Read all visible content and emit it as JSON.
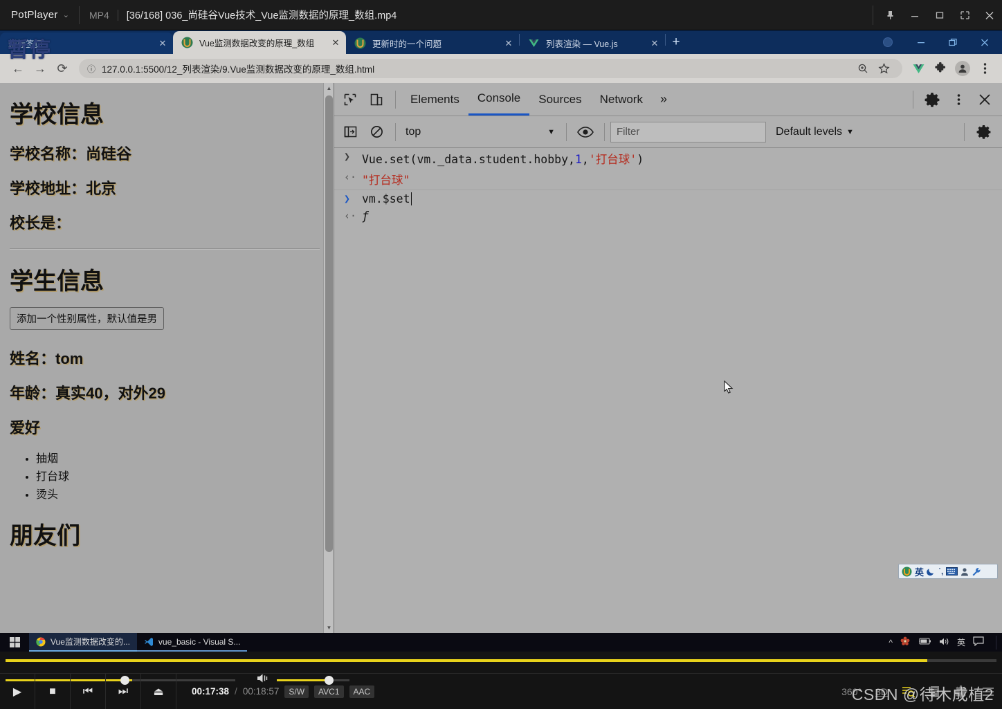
{
  "potplayer": {
    "app_name": "PotPlayer",
    "chevron": "⌄",
    "format": "MP4",
    "file_title": "[36/168] 036_尚硅谷Vue技术_Vue监测数据的原理_数组.mp4",
    "osd_text": "暂停",
    "window_buttons": [
      "pin",
      "minimize",
      "maximize",
      "fullscreen",
      "close"
    ],
    "controls": {
      "play_label": "▶",
      "stop_label": "■",
      "prev_label": "⏮",
      "next_label": "⏭",
      "eject_label": "⏏",
      "current_time": "00:17:38",
      "separator": "/",
      "total_time": "00:18:57",
      "badges": [
        "S/W",
        "AVC1",
        "AAC"
      ],
      "right_buttons": [
        "360°",
        "3D",
        "playlist-search",
        "playlist",
        "settings",
        "menu"
      ],
      "seek_percent": 93,
      "volume_percent": 72
    },
    "watermark": "CSDN @待木成植2"
  },
  "chrome": {
    "tabs": [
      {
        "title": "新标签页",
        "favicon": "none",
        "active": false
      },
      {
        "title": "Vue监测数据改变的原理_数组",
        "favicon": "vue-u",
        "active": true
      },
      {
        "title": "更新时的一个问题",
        "favicon": "vue-u",
        "active": false
      },
      {
        "title": "列表渲染 — Vue.js",
        "favicon": "vue-v",
        "active": false
      }
    ],
    "tab_close_label": "✕",
    "new_tab_label": "+",
    "window_buttons": [
      "minimize",
      "restore",
      "close"
    ],
    "toolbar": {
      "back_label": "←",
      "forward_label": "→",
      "reload_label": "⟳",
      "site_info_label": "ⓘ",
      "url": "127.0.0.1:5500/12_列表渲染/9.Vue监测数据改变的原理_数组.html",
      "icons": [
        "zoom-icon",
        "bookmark-star-icon",
        "vue-devtools-icon",
        "extensions-icon",
        "profile-icon",
        "menu-icon"
      ]
    }
  },
  "page": {
    "school_heading": "学校信息",
    "school_name": "学校名称：尚硅谷",
    "school_address": "学校地址：北京",
    "principal": "校长是：",
    "student_heading": "学生信息",
    "add_gender_button": "添加一个性别属性，默认值是男",
    "name": "姓名：tom",
    "age": "年龄：真实40，对外29",
    "hobby_heading": "爱好",
    "hobbies": [
      "抽烟",
      "打台球",
      "烫头"
    ],
    "friends_heading": "朋友们"
  },
  "devtools": {
    "inspect_icon": "inspect-element-icon",
    "device_icon": "device-toolbar-icon",
    "tabs": [
      "Elements",
      "Console",
      "Sources",
      "Network"
    ],
    "active_tab": "Console",
    "more_tabs_label": "»",
    "settings_icon": "gear-icon",
    "kebab_icon": "more-options-icon",
    "close_icon": "close-icon",
    "console_toolbar": {
      "sidebar_icon": "console-sidebar-icon",
      "clear_icon": "clear-console-icon",
      "context": "top",
      "context_caret": "▼",
      "eye_icon": "live-expression-icon",
      "filter_placeholder": "Filter",
      "filter_value": "",
      "levels_label": "Default levels",
      "levels_caret": "▼",
      "settings_icon": "console-settings-icon"
    },
    "console_rows": [
      {
        "kind": "input",
        "arrow": "❯",
        "segments": [
          {
            "t": "Vue.set(vm._data.student.hobby,",
            "c": "plain"
          },
          {
            "t": "1",
            "c": "num"
          },
          {
            "t": ",",
            "c": "plain"
          },
          {
            "t": "'打台球'",
            "c": "str"
          },
          {
            "t": ")",
            "c": "plain"
          }
        ]
      },
      {
        "kind": "result",
        "arrow": "‹·",
        "segments": [
          {
            "t": "\"打台球\"",
            "c": "str"
          }
        ]
      },
      {
        "kind": "prompt",
        "arrow": "❯",
        "segments": [
          {
            "t": "vm.$set",
            "c": "plain"
          }
        ]
      },
      {
        "kind": "result",
        "arrow": "‹·",
        "segments": [
          {
            "t": "ƒ",
            "c": "plain"
          }
        ]
      }
    ]
  },
  "ime": {
    "icons": [
      "sogou-logo-icon",
      "chinese-mode-icon",
      "moon-icon",
      "punctuation-icon",
      "keyboard-icon",
      "user-icon",
      "toolbox-icon"
    ],
    "mode_label": "英"
  },
  "taskbar": {
    "start_label": "start-icon",
    "items": [
      {
        "label": "Vue监测数据改变的...",
        "icon": "chrome-icon",
        "active": true
      },
      {
        "label": "vue_basic - Visual S...",
        "icon": "vscode-icon",
        "active": false
      }
    ],
    "tray": [
      "^",
      "flower-icon",
      "battery-icon",
      "volume-icon",
      "英",
      "notification-icon"
    ]
  },
  "colors": {
    "chrome_tab_bar": "#0d2d5c",
    "devtools_accent": "#1a56c4",
    "potplayer_seek": "#e8d21b",
    "page_bg": "#a9a9a9"
  }
}
